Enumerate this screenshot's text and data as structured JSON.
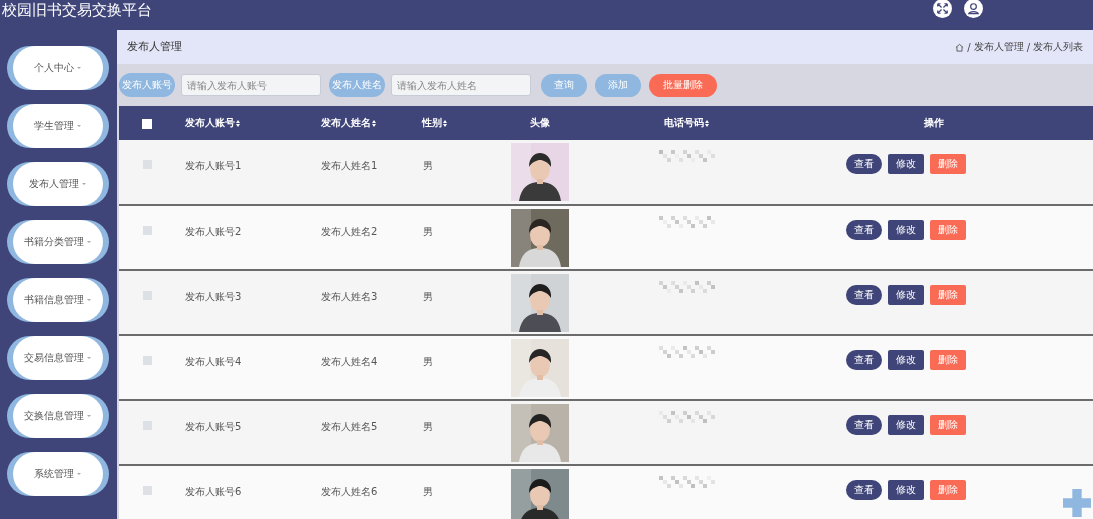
{
  "app": {
    "title": "校园旧书交易交换平台"
  },
  "sidebar": {
    "items": [
      {
        "label": "个人中心"
      },
      {
        "label": "学生管理"
      },
      {
        "label": "发布人管理"
      },
      {
        "label": "书籍分类管理"
      },
      {
        "label": "书籍信息管理"
      },
      {
        "label": "交易信息管理"
      },
      {
        "label": "交换信息管理"
      },
      {
        "label": "系统管理"
      }
    ]
  },
  "page": {
    "title": "发布人管理",
    "breadcrumb_separator": "/",
    "breadcrumb": [
      "发布人管理",
      "发布人列表"
    ]
  },
  "search": {
    "fields": [
      {
        "label": "发布人账号",
        "placeholder": "请输入发布人账号"
      },
      {
        "label": "发布人姓名",
        "placeholder": "请输入发布人姓名"
      }
    ],
    "buttons": [
      {
        "label": "查询",
        "kind": "query"
      },
      {
        "label": "添加",
        "kind": "add"
      },
      {
        "label": "批量删除",
        "kind": "danger"
      }
    ]
  },
  "table": {
    "select_all": {
      "checked": false
    },
    "columns": [
      {
        "label": "发布人账号",
        "sortable": true
      },
      {
        "label": "发布人姓名",
        "sortable": true
      },
      {
        "label": "性别",
        "sortable": true
      },
      {
        "label": "头像",
        "sortable": false
      },
      {
        "label": "电话号码",
        "sortable": true
      },
      {
        "label": "操作",
        "sortable": false
      }
    ],
    "rows": [
      {
        "checked": false,
        "account": "发布人账号1",
        "name": "发布人姓名1",
        "gender": "男",
        "actions": [
          {
            "label": "查看",
            "kind": "view"
          },
          {
            "label": "修改",
            "kind": "edit"
          },
          {
            "label": "删除",
            "kind": "delete"
          }
        ]
      },
      {
        "checked": false,
        "account": "发布人账号2",
        "name": "发布人姓名2",
        "gender": "男",
        "actions": [
          {
            "label": "查看",
            "kind": "view"
          },
          {
            "label": "修改",
            "kind": "edit"
          },
          {
            "label": "删除",
            "kind": "delete"
          }
        ]
      },
      {
        "checked": false,
        "account": "发布人账号3",
        "name": "发布人姓名3",
        "gender": "男",
        "actions": [
          {
            "label": "查看",
            "kind": "view"
          },
          {
            "label": "修改",
            "kind": "edit"
          },
          {
            "label": "删除",
            "kind": "delete"
          }
        ]
      },
      {
        "checked": false,
        "account": "发布人账号4",
        "name": "发布人姓名4",
        "gender": "男",
        "actions": [
          {
            "label": "查看",
            "kind": "view"
          },
          {
            "label": "修改",
            "kind": "edit"
          },
          {
            "label": "删除",
            "kind": "delete"
          }
        ]
      },
      {
        "checked": false,
        "account": "发布人账号5",
        "name": "发布人姓名5",
        "gender": "男",
        "actions": [
          {
            "label": "查看",
            "kind": "view"
          },
          {
            "label": "修改",
            "kind": "edit"
          },
          {
            "label": "删除",
            "kind": "delete"
          }
        ]
      },
      {
        "checked": false,
        "account": "发布人账号6",
        "name": "发布人姓名6",
        "gender": "男",
        "actions": [
          {
            "label": "查看",
            "kind": "view"
          },
          {
            "label": "修改",
            "kind": "edit"
          },
          {
            "label": "删除",
            "kind": "delete"
          }
        ]
      }
    ]
  }
}
